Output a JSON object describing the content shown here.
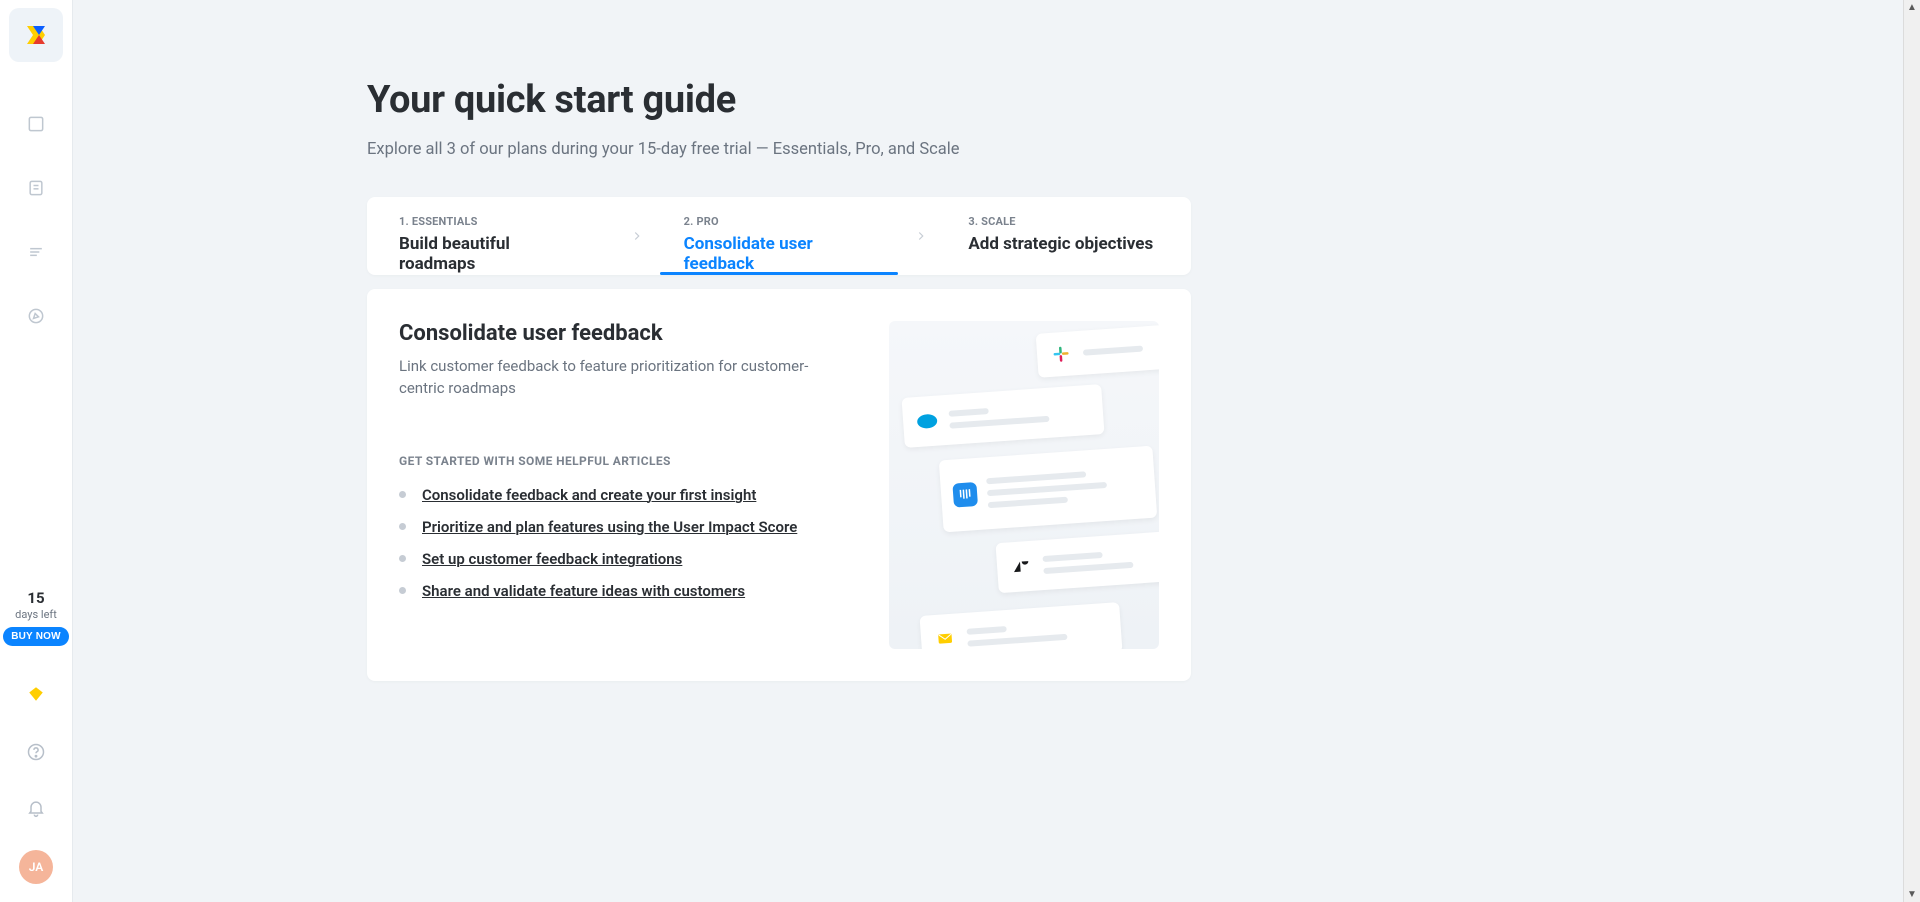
{
  "sidebar": {
    "trial": {
      "days": "15",
      "days_left_label": "days left",
      "buy_label": "BUY NOW"
    },
    "avatar_initials": "JA"
  },
  "page": {
    "title": "Your quick start guide",
    "subtitle": "Explore all 3 of our plans during your 15-day free trial — Essentials, Pro, and Scale"
  },
  "tabs": [
    {
      "kicker": "1. ESSENTIALS",
      "title": "Build beautiful roadmaps",
      "active": false
    },
    {
      "kicker": "2. PRO",
      "title": "Consolidate user feedback",
      "active": true
    },
    {
      "kicker": "3. SCALE",
      "title": "Add strategic objectives",
      "active": false
    }
  ],
  "detail": {
    "title": "Consolidate user feedback",
    "description": "Link customer feedback to feature prioritization for customer-centric roadmaps",
    "articles_heading": "GET STARTED WITH SOME HELPFUL ARTICLES",
    "articles": [
      "Consolidate feedback and create your first insight",
      "Prioritize and plan features using the User Impact Score",
      "Set up customer feedback integrations",
      "Share and validate feature ideas with customers"
    ]
  }
}
